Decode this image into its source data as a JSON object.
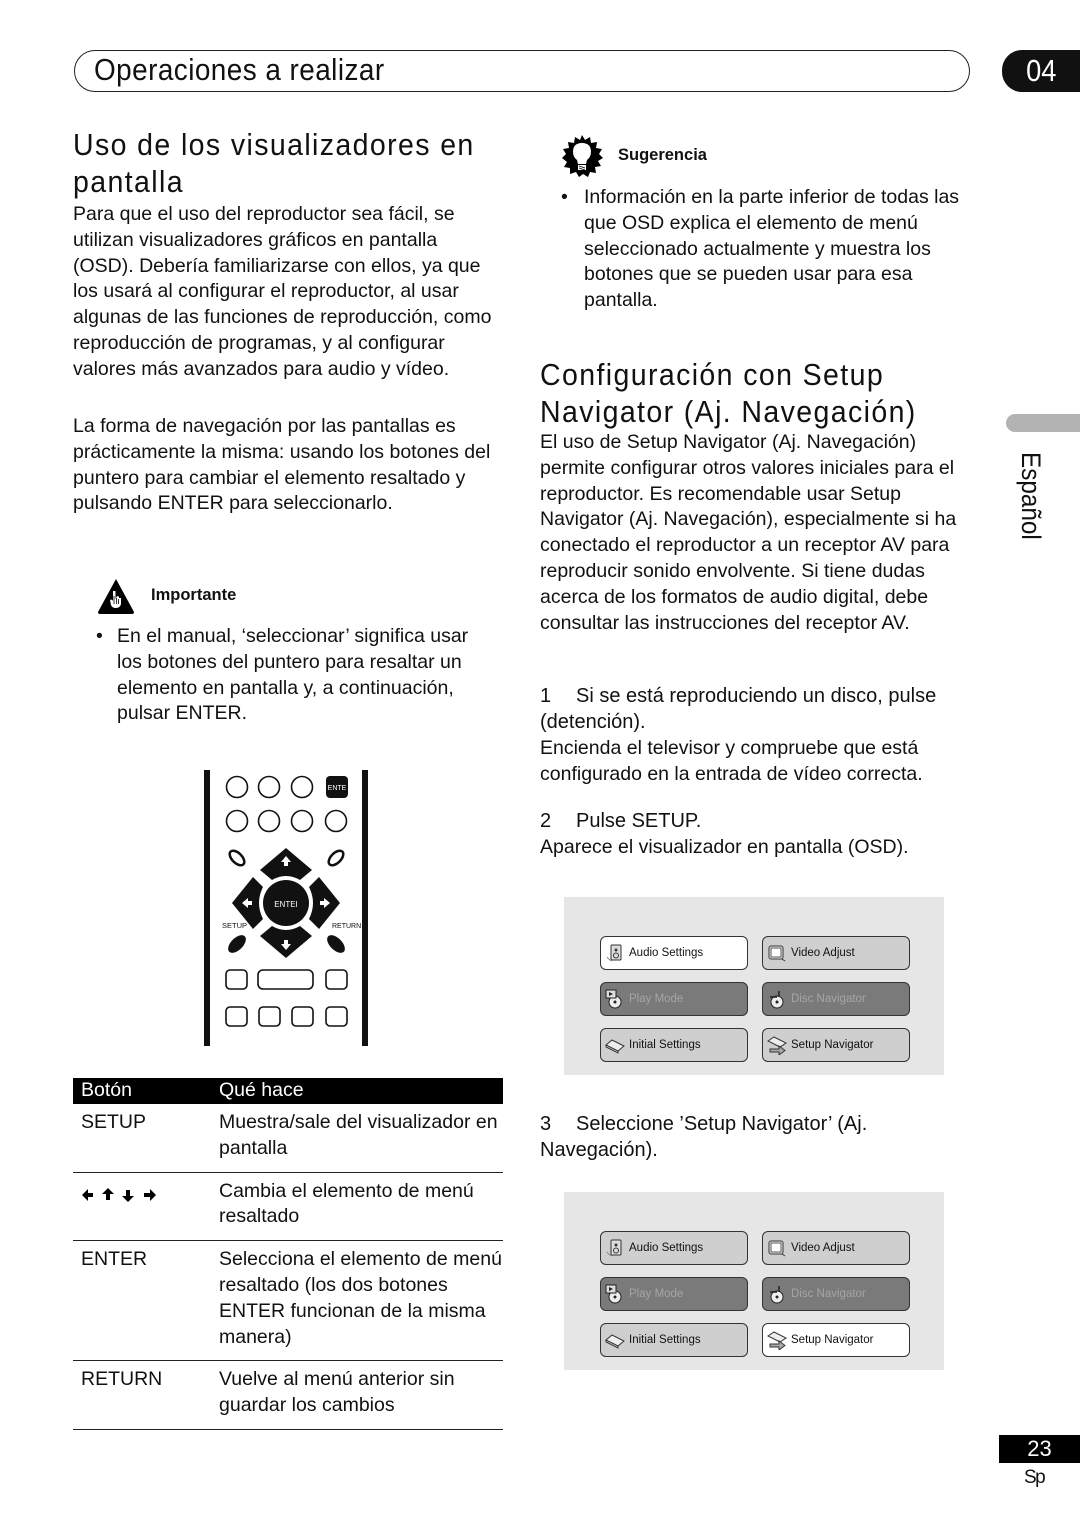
{
  "header": {
    "section_title": "Operaciones a realizar",
    "chapter_number": "04"
  },
  "left": {
    "heading": "Uso de los visualizadores en pantalla",
    "paragraph1": "Para que el uso del reproductor sea fácil, se utilizan visualizadores gráficos en pantalla (OSD). Debería familiarizarse con ellos, ya que los usará al configurar el reproductor, al usar algunas de las funciones de reproducción, como reproducción de programas, y al configurar valores más avanzados para audio y vídeo.",
    "paragraph2": "La forma de navegación por las pantallas es prácticamente la misma: usando los botones del puntero para cambiar el elemento resaltado y pulsando ENTER para seleccionarlo.",
    "important": {
      "icon": "hand-warning-icon",
      "label": "Importante",
      "bullet": "En el manual, ‘seleccionar’ significa usar los botones del puntero para resaltar un elemento en pantalla y, a continuación, pulsar ENTER."
    },
    "remote": {
      "enter_top_label": "ENTE",
      "enter_center_label": "ENTEI",
      "setup_label": "SETUP",
      "return_label": "RETURN"
    },
    "table": {
      "headers": [
        "Botón",
        "Qué hace"
      ],
      "rows": [
        {
          "button": "SETUP",
          "action": "Muestra/sale del visualizador en pantalla"
        },
        {
          "button": "←↑↓→",
          "button_icon": "arrow-keys-icon",
          "action": "Cambia el elemento de menú resaltado"
        },
        {
          "button": "ENTER",
          "action": "Selecciona el elemento de menú resaltado (los dos botones ENTER funcionan de la misma manera)"
        },
        {
          "button": "RETURN",
          "action": "Vuelve al menú anterior sin guardar los cambios"
        }
      ]
    }
  },
  "right": {
    "tip": {
      "icon": "lightbulb-icon",
      "label": "Sugerencia",
      "bullet": "Información en la parte inferior de todas las que OSD explica el elemento de menú seleccionado actualmente y muestra los botones que se pueden usar para esa pantalla."
    },
    "heading_line1": "Configuración con Setup",
    "heading_line2": "Navigator (Aj. Navegación)",
    "paragraph": "El uso de Setup Navigator (Aj. Navegación) permite configurar otros valores iniciales para el reproductor. Es recomendable usar Setup Navigator (Aj. Navegación), especialmente si ha conectado el reproductor a un receptor AV para reproducir sonido envolvente. Si tiene dudas acerca de los formatos de audio digital, debe consultar las instrucciones del receptor AV.",
    "steps": [
      {
        "num": "1",
        "title": "Si se está reproduciendo un disco, pulse    (detención).",
        "body": "Encienda el televisor y compruebe que está configurado en la entrada de vídeo correcta."
      },
      {
        "num": "2",
        "title": "Pulse SETUP.",
        "body": "Aparece el visualizador en pantalla (OSD)."
      },
      {
        "num": "3",
        "title": "Seleccione ’Setup Navigator’ (Aj. Navegación).",
        "body": ""
      }
    ],
    "osd_screens": [
      {
        "selected": "Audio Settings",
        "items": [
          {
            "label": "Audio Settings",
            "icon": "speaker-icon",
            "state": "selected"
          },
          {
            "label": "Video Adjust",
            "icon": "monitor-icon",
            "state": "normal"
          },
          {
            "label": "Play Mode",
            "icon": "play-disc-icon",
            "state": "disabled"
          },
          {
            "label": "Disc Navigator",
            "icon": "disc-navigator-icon",
            "state": "disabled"
          },
          {
            "label": "Initial Settings",
            "icon": "initial-settings-icon",
            "state": "normal"
          },
          {
            "label": "Setup Navigator",
            "icon": "setup-navigator-icon",
            "state": "normal"
          }
        ]
      },
      {
        "selected": "Setup Navigator",
        "items": [
          {
            "label": "Audio Settings",
            "icon": "speaker-icon",
            "state": "normal"
          },
          {
            "label": "Video Adjust",
            "icon": "monitor-icon",
            "state": "normal"
          },
          {
            "label": "Play Mode",
            "icon": "play-disc-icon",
            "state": "disabled"
          },
          {
            "label": "Disc Navigator",
            "icon": "disc-navigator-icon",
            "state": "disabled"
          },
          {
            "label": "Initial Settings",
            "icon": "initial-settings-icon",
            "state": "normal"
          },
          {
            "label": "Setup Navigator",
            "icon": "setup-navigator-icon",
            "state": "selected"
          }
        ]
      }
    ]
  },
  "side_tab": {
    "language": "Español"
  },
  "footer": {
    "page_number": "23",
    "language_code": "Sp"
  }
}
